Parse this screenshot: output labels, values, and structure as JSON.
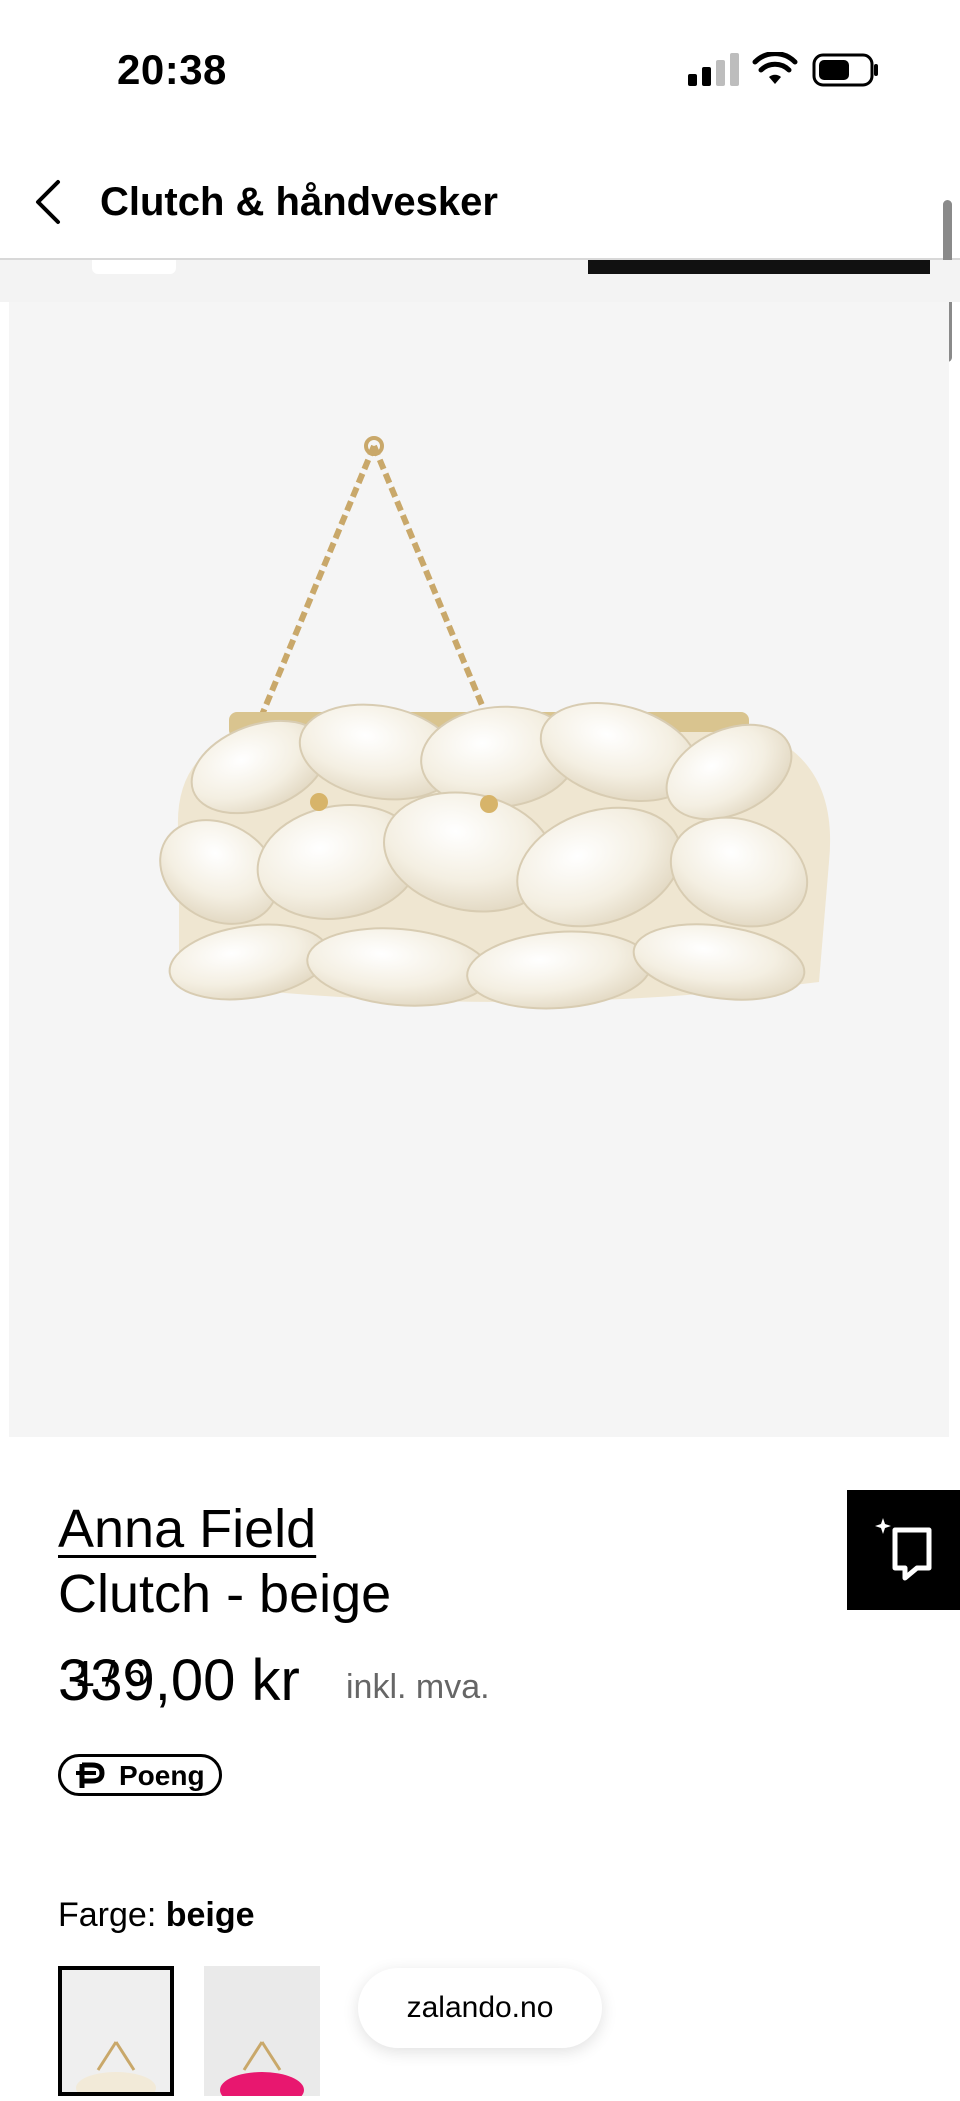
{
  "status_bar": {
    "time": "20:38"
  },
  "header": {
    "title": "Clutch & håndvesker"
  },
  "gallery": {
    "counter": "1 / 6"
  },
  "product": {
    "brand": "Anna Field",
    "name": "Clutch - beige",
    "price": "339,00 kr",
    "vat_note": "inkl. mva."
  },
  "points": {
    "label": "Poeng"
  },
  "color": {
    "label": "Farge: ",
    "value": "beige"
  },
  "browser": {
    "domain": "zalando.no"
  },
  "colors": {
    "accent": "#000000",
    "gallery_bg": "#f5f5f5",
    "alt_swatch": "#e8176f"
  },
  "icons": [
    "back-chevron-icon",
    "signal-icon",
    "wifi-icon",
    "battery-icon",
    "ai-sparkle-chat-icon",
    "points-p-icon"
  ]
}
